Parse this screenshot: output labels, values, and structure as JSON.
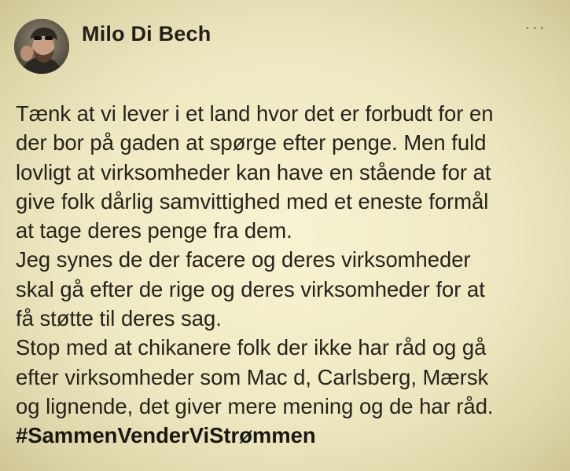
{
  "post": {
    "author_name": "Milo Di Bech",
    "more_menu": "···",
    "lines": [
      "Tænk at vi lever i et land hvor det er forbudt for en",
      "der bor på gaden at spørge efter penge. Men fuld",
      "lovligt at virksomheder kan have en stående for at",
      "give folk dårlig samvittighed med et eneste formål",
      "at tage deres penge fra dem.",
      "Jeg synes de der facere og deres virksomheder",
      "skal gå efter de rige og deres virksomheder for at",
      "få støtte til deres sag.",
      "Stop med at chikanere folk der ikke har råd og gå",
      "efter virksomheder som Mac d, Carlsberg, Mærsk",
      "og lignende, det giver mere mening og de har råd."
    ],
    "hashtag": "#SammenVenderViStrømmen",
    "avatar_icon": "user-photo"
  },
  "colors": {
    "background": "#f3eecb",
    "text": "#262219",
    "menu": "#7c7664"
  }
}
